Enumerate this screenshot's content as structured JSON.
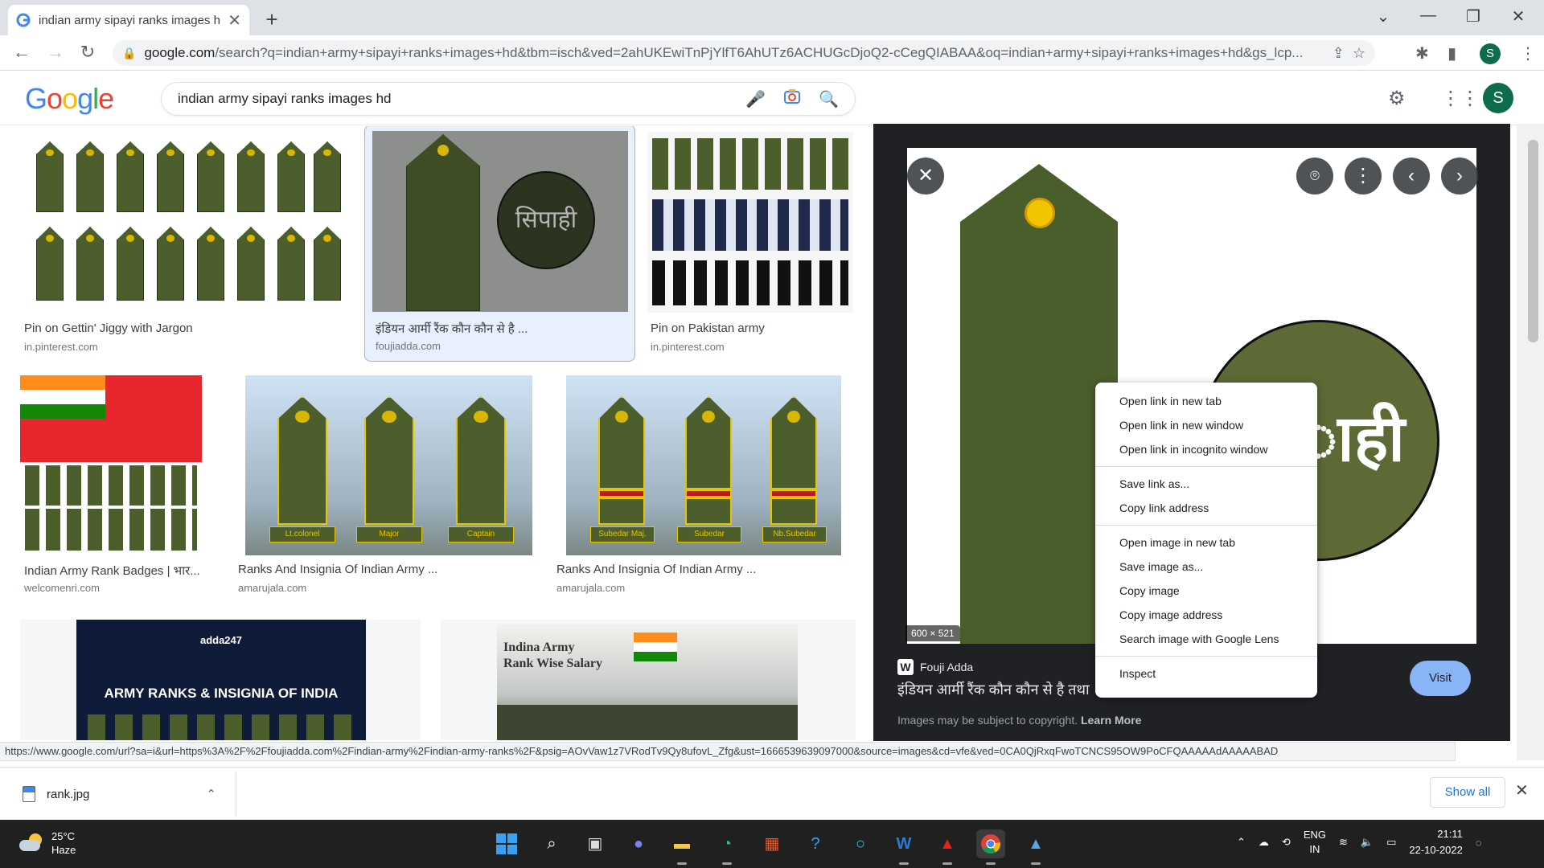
{
  "browser": {
    "tab_title": "indian army sipayi ranks images hd - Google Search",
    "url_host": "google.com",
    "url_path": "/search?q=indian+army+sipayi+ranks+images+hd&tbm=isch&ved=2ahUKEwiTnPjYlfT6AhUTz6ACHUGcDjoQ2-cCegQIABAA&oq=indian+army+sipayi+ranks+images+hd&gs_lcp...",
    "profile_initial": "S"
  },
  "google": {
    "logo": [
      "G",
      "o",
      "o",
      "g",
      "l",
      "e"
    ],
    "query": "indian army sipayi ranks images hd",
    "profile_initial": "S"
  },
  "results": [
    {
      "title": "Pin on Gettin' Jiggy with Jargon",
      "source": "in.pinterest.com"
    },
    {
      "title": "इंडियन आर्मी रैंक कौन कौन से है ...",
      "source": "foujiadda.com",
      "overlay_text": "सिपाही"
    },
    {
      "title": "Pin on Pakistan army",
      "source": "in.pinterest.com"
    },
    {
      "title": "Indian Army Rank Badges | भार...",
      "source": "welcomenri.com"
    },
    {
      "title": "Ranks And Insignia Of Indian Army ...",
      "source": "amarujala.com",
      "labels": [
        "Lt.colonel",
        "Major",
        "Captain"
      ]
    },
    {
      "title": "Ranks And Insignia Of Indian Army ...",
      "source": "amarujala.com",
      "labels": [
        "Subedar Maj.",
        "Subedar",
        "Nb.Subedar"
      ]
    },
    {
      "banner_brand": "adda247",
      "banner_title": "ARMY RANKS & INSIGNIA OF INDIA"
    },
    {
      "banner_title_1": "Indina Army",
      "banner_title_2": "Rank Wise Salary"
    }
  ],
  "preview": {
    "overlay_text": "ाही",
    "dimensions": "600 × 521",
    "source_name": "Fouji Adda",
    "title": "इंडियन आर्मी रैंक कौन कौन से है तथा",
    "visit_label": "Visit",
    "copyright_text": "Images may be subject to copyright.",
    "learn_more": "Learn More"
  },
  "context_menu": {
    "group1": [
      "Open link in new tab",
      "Open link in new window",
      "Open link in incognito window"
    ],
    "group2": [
      "Save link as...",
      "Copy link address"
    ],
    "group3": [
      "Open image in new tab",
      "Save image as...",
      "Copy image",
      "Copy image address",
      "Search image with Google Lens"
    ],
    "group4": [
      "Inspect"
    ]
  },
  "status_url": "https://www.google.com/url?sa=i&url=https%3A%2F%2Ffoujiadda.com%2Findian-army%2Findian-army-ranks%2F&psig=AOvVaw1z7VRodTv9Qy8ufovL_Zfg&ust=1666539639097000&source=images&cd=vfe&ved=0CA0QjRxqFwoTCNCS95OW9PoCFQAAAAAdAAAAABAD",
  "downloads": {
    "file": "rank.jpg",
    "show_all": "Show all"
  },
  "taskbar": {
    "temperature": "25°C",
    "condition": "Haze",
    "lang_1": "ENG",
    "lang_2": "IN",
    "time": "21:11",
    "date": "22-10-2022"
  },
  "colors": {
    "accent_blue": "#1a73e8",
    "olive": "#4b5e2b",
    "visit": "#8ab4f8"
  }
}
